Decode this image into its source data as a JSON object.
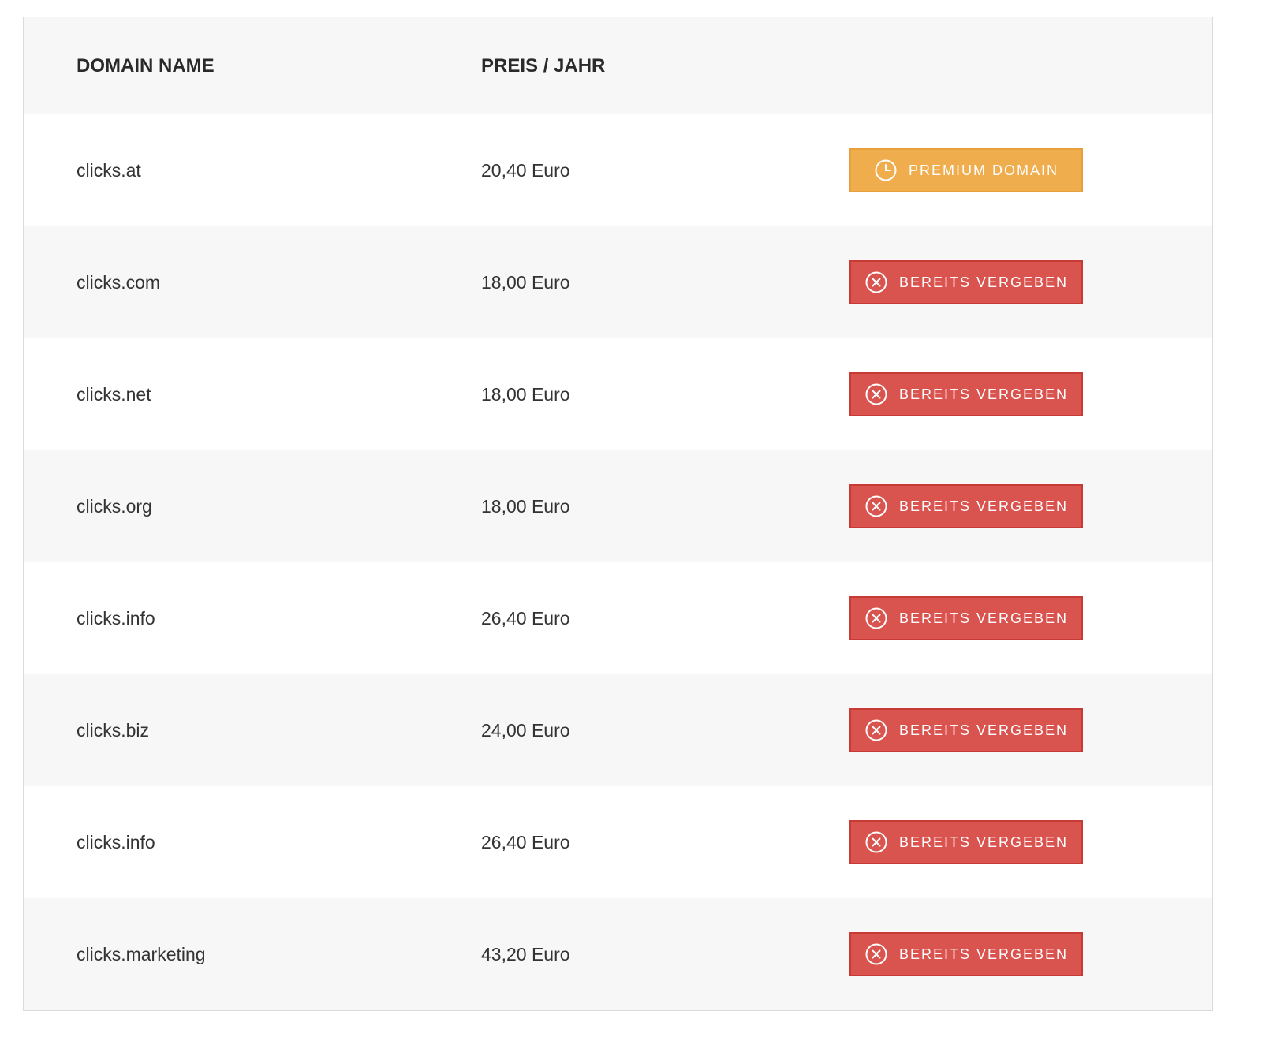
{
  "table": {
    "headers": {
      "domain": "DOMAIN NAME",
      "price": "PREIS / JAHR"
    },
    "rows": [
      {
        "domain": "clicks.at",
        "price": "20,40 Euro",
        "status": "premium",
        "label": "PREMIUM DOMAIN",
        "icon": "clock-icon"
      },
      {
        "domain": "clicks.com",
        "price": "18,00 Euro",
        "status": "taken",
        "label": "BEREITS VERGEBEN",
        "icon": "x-circle-icon"
      },
      {
        "domain": "clicks.net",
        "price": "18,00 Euro",
        "status": "taken",
        "label": "BEREITS VERGEBEN",
        "icon": "x-circle-icon"
      },
      {
        "domain": "clicks.org",
        "price": "18,00 Euro",
        "status": "taken",
        "label": "BEREITS VERGEBEN",
        "icon": "x-circle-icon"
      },
      {
        "domain": "clicks.info",
        "price": "26,40 Euro",
        "status": "taken",
        "label": "BEREITS VERGEBEN",
        "icon": "x-circle-icon"
      },
      {
        "domain": "clicks.biz",
        "price": "24,00 Euro",
        "status": "taken",
        "label": "BEREITS VERGEBEN",
        "icon": "x-circle-icon"
      },
      {
        "domain": "clicks.info",
        "price": "26,40 Euro",
        "status": "taken",
        "label": "BEREITS VERGEBEN",
        "icon": "x-circle-icon"
      },
      {
        "domain": "clicks.marketing",
        "price": "43,20 Euro",
        "status": "taken",
        "label": "BEREITS VERGEBEN",
        "icon": "x-circle-icon"
      }
    ]
  },
  "colors": {
    "premium": "#f0ad4e",
    "taken": "#d9534f",
    "header_bg": "#f7f7f7",
    "row_alt_bg": "#f7f7f7"
  }
}
